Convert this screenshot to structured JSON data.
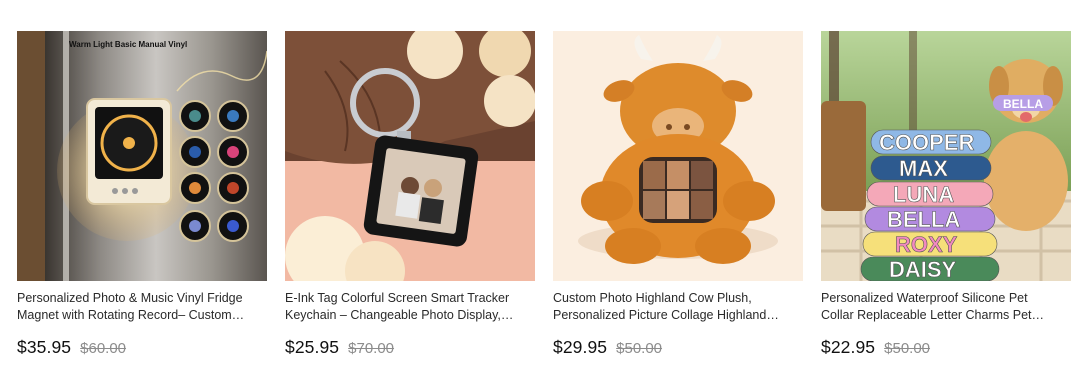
{
  "products": [
    {
      "image_alt": "Vinyl fridge magnet with rotating record",
      "image_overlay_text": "Warm Light Basic Manual Vinyl",
      "title_line1": "Personalized Photo & Music Vinyl Fridge",
      "title_line2": "Magnet with Rotating Record– Custom…",
      "price": "$35.95",
      "compare_price": "$60.00"
    },
    {
      "image_alt": "E-Ink photo keychain",
      "title_line1": "E-Ink Tag Colorful Screen Smart Tracker",
      "title_line2": "Keychain – Changeable Photo Display,…",
      "price": "$25.95",
      "compare_price": "$70.00"
    },
    {
      "image_alt": "Highland cow plush with photo collage",
      "title_line1": "Custom Photo Highland Cow Plush,",
      "title_line2": "Personalized Picture Collage Highland…",
      "price": "$29.95",
      "compare_price": "$50.00"
    },
    {
      "image_alt": "Silicone pet collars with letter charms",
      "collar_names": [
        "COOPER",
        "MAX",
        "LUNA",
        "BELLA",
        "ROXY",
        "DAISY"
      ],
      "dog_collar_name": "BELLA",
      "title_line1": "Personalized Waterproof Silicone Pet",
      "title_line2": "Collar Replaceable Letter Charms Pet…",
      "price": "$22.95",
      "compare_price": "$50.00"
    }
  ],
  "colors": {
    "price": "#111111",
    "compare_price": "#8c8c8c",
    "title": "#2a2a2a"
  }
}
